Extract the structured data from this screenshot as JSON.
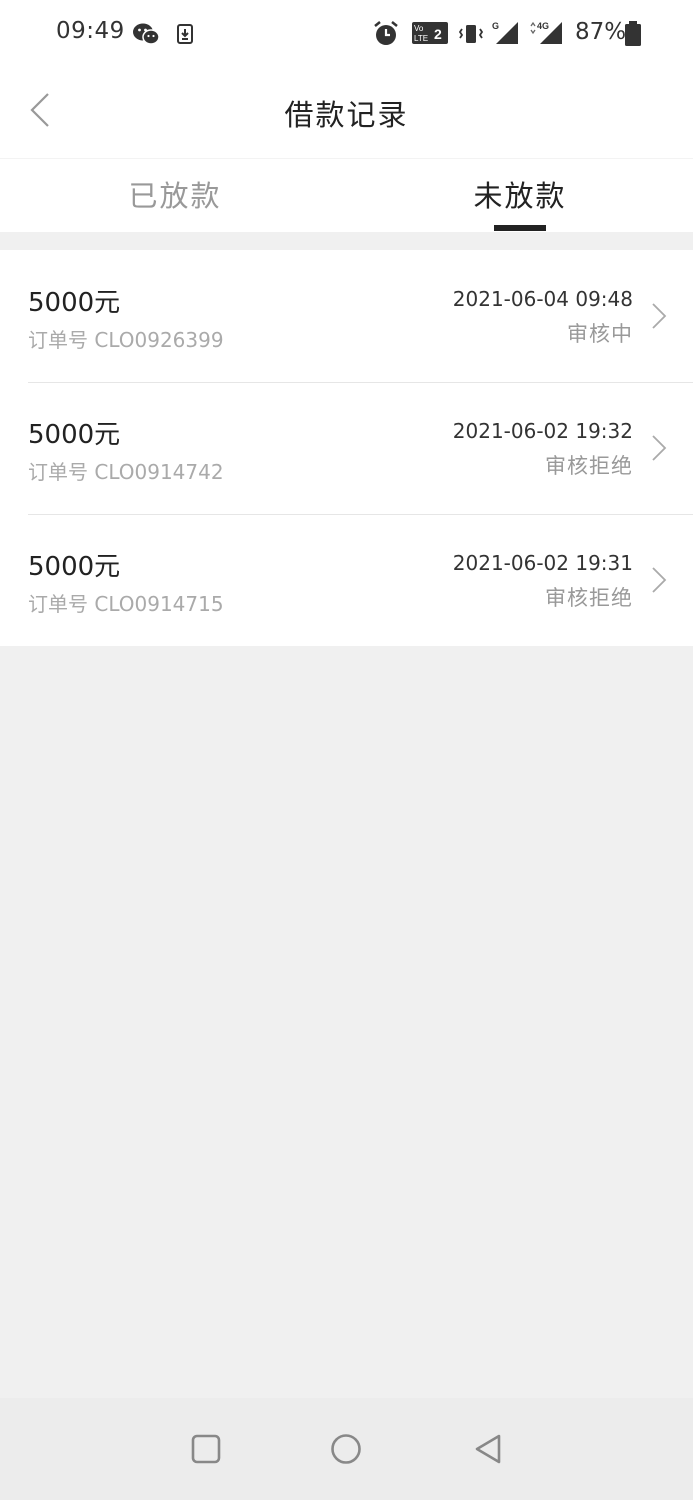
{
  "status_bar": {
    "time": "09:49",
    "battery": "87%",
    "icons": [
      "wechat-icon",
      "download-icon",
      "alarm-icon",
      "volte-icon",
      "vibrate-icon",
      "signal-g-icon",
      "signal-4g-icon",
      "battery-icon"
    ]
  },
  "header": {
    "title": "借款记录",
    "back_icon": "chevron-left-icon"
  },
  "tabs": [
    {
      "label": "已放款",
      "active": false
    },
    {
      "label": "未放款",
      "active": true
    }
  ],
  "records": [
    {
      "amount": "5000元",
      "order": "订单号 CLO0926399",
      "datetime": "2021-06-04 09:48",
      "status": "审核中"
    },
    {
      "amount": "5000元",
      "order": "订单号 CLO0914742",
      "datetime": "2021-06-02 19:32",
      "status": "审核拒绝"
    },
    {
      "amount": "5000元",
      "order": "订单号 CLO0914715",
      "datetime": "2021-06-02 19:31",
      "status": "审核拒绝"
    }
  ],
  "system_nav": {
    "icons": [
      "square-icon",
      "circle-icon",
      "triangle-icon"
    ]
  },
  "colors": {
    "background": "#f0f0f0",
    "surface": "#ffffff",
    "primary_text": "#222222",
    "secondary_text": "#999999",
    "indicator": "#222222"
  }
}
